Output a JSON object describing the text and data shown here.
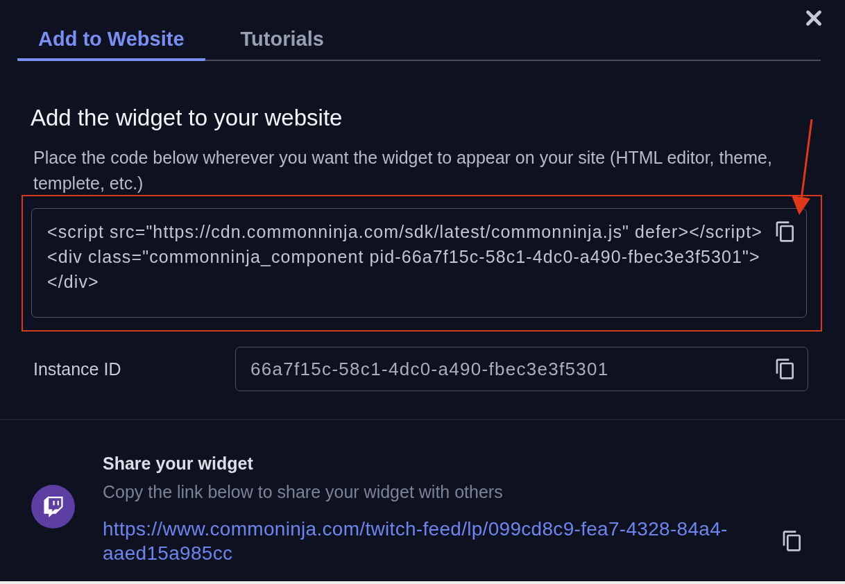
{
  "tabs": [
    {
      "label": "Add to Website",
      "selected": true
    },
    {
      "label": "Tutorials",
      "selected": false
    }
  ],
  "embed": {
    "title": "Add the widget to your website",
    "description": "Place the code below wherever you want the widget to appear on your site (HTML editor, theme, templete, etc.)",
    "code_lines": [
      "<script src=\"https://cdn.commonninja.com/sdk/latest/commonninja.js\" defer></script>",
      "<div class=\"commonninja_component pid-66a7f15c-58c1-4dc0-a490-fbec3e3f5301\">",
      "</div>"
    ]
  },
  "instance": {
    "label": "Instance ID",
    "value": "66a7f15c-58c1-4dc0-a490-fbec3e3f5301"
  },
  "share": {
    "title": "Share your widget",
    "subtitle": "Copy the link below to share your widget with others",
    "link": "https://www.commoninja.com/twitch-feed/lp/099cd8c9-fea7-4328-84a4-aaed15a985cc"
  }
}
